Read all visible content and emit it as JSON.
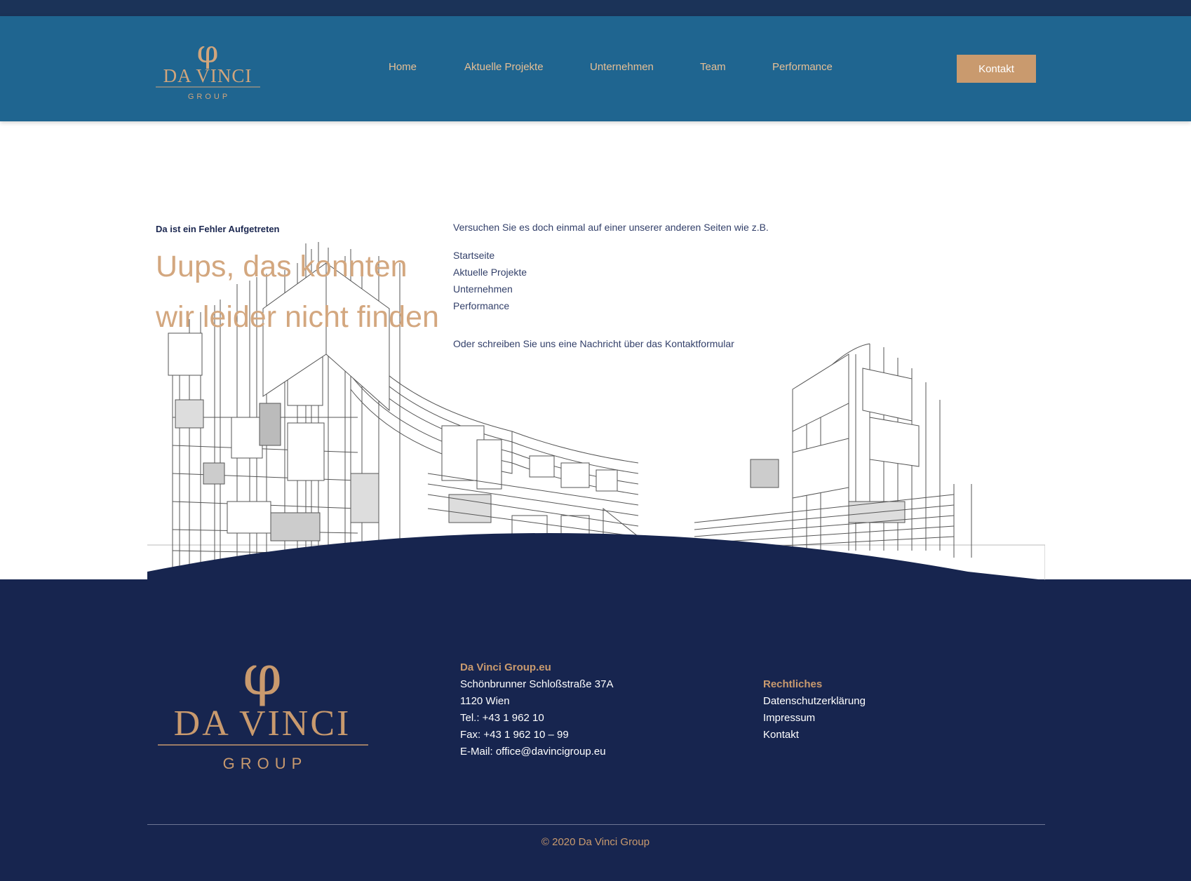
{
  "header": {
    "logo_phi": "φ",
    "logo_word": "DA VINCI",
    "logo_sub": "GROUP",
    "nav": [
      "Home",
      "Aktuelle Projekte",
      "Unternehmen",
      "Team",
      "Performance"
    ],
    "contact_button": "Kontakt"
  },
  "error": {
    "kicker": "Da ist ein Fehler Aufgetreten",
    "title_line1": "Uups, das konnten",
    "title_line2": "wir leider nicht finden",
    "suggest": "Versuchen Sie es doch einmal auf einer unserer anderen Seiten wie z.B.",
    "links": [
      "Startseite",
      "Aktuelle Projekte",
      "Unternehmen",
      "Performance"
    ],
    "contact_line": "Oder schreiben Sie uns eine Nachricht über das Kontaktformular"
  },
  "footer": {
    "company": {
      "title": "Da Vinci Group.eu",
      "address": "Schönbrunner Schloßstraße 37A",
      "city": "1120 Wien",
      "tel": "Tel.: +43 1 962 10",
      "fax": "Fax: +43 1 962 10 – 99",
      "email": "E-Mail: office@davincigroup.eu"
    },
    "legal": {
      "title": "Rechtliches",
      "links": [
        "Datenschutzerklärung",
        "Impressum",
        "Kontakt"
      ]
    },
    "copyright": "© 2020 Da Vinci Group"
  },
  "colors": {
    "header_bg": "#1f6590",
    "footer_bg": "#17254f",
    "accent": "#c99a6e",
    "title": "#d3a77f"
  }
}
